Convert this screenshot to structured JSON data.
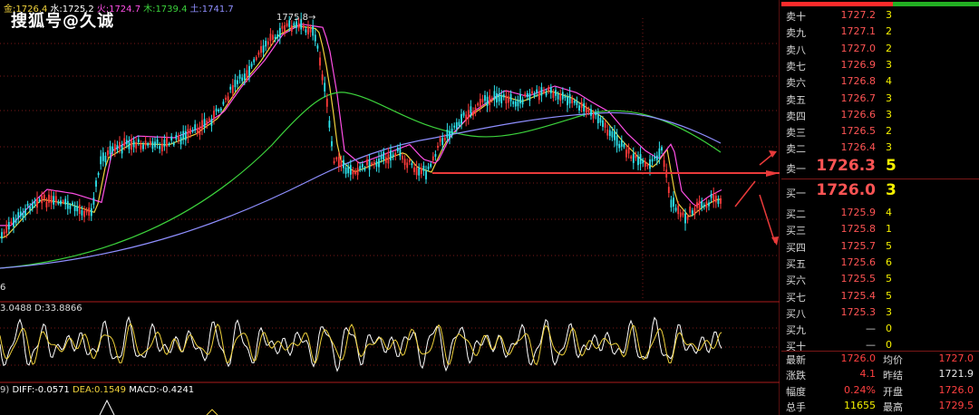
{
  "watermark": "搜狐号@久诚",
  "ma_legend": [
    {
      "text": "金:1726.4",
      "color": "#f0d23c"
    },
    {
      "text": "水:1725.2",
      "color": "#ffffff"
    },
    {
      "text": "火:1724.7",
      "color": "#ff4fe6"
    },
    {
      "text": "木:1739.4",
      "color": "#3cd23c"
    },
    {
      "text": "土:1741.7",
      "color": "#8f8fff"
    }
  ],
  "peak_label": "1775.8→",
  "y_edge_label": "6",
  "kdj_legend": "3.0488 D:33.8866",
  "macd_legend": [
    {
      "text": "9) ",
      "color": "#cccccc"
    },
    {
      "text": "DIFF:-0.0571 ",
      "color": "#ffffff"
    },
    {
      "text": "DEA:0.1549 ",
      "color": "#f0d23c"
    },
    {
      "text": "MACD:-0.4241",
      "color": "#ffffff"
    }
  ],
  "orderbook": {
    "asks": [
      {
        "label": "卖十",
        "price": "1727.2",
        "vol": "3"
      },
      {
        "label": "卖九",
        "price": "1727.1",
        "vol": "2"
      },
      {
        "label": "卖八",
        "price": "1727.0",
        "vol": "2"
      },
      {
        "label": "卖七",
        "price": "1726.9",
        "vol": "3"
      },
      {
        "label": "卖六",
        "price": "1726.8",
        "vol": "4"
      },
      {
        "label": "卖五",
        "price": "1726.7",
        "vol": "3"
      },
      {
        "label": "卖四",
        "price": "1726.6",
        "vol": "3"
      },
      {
        "label": "卖三",
        "price": "1726.5",
        "vol": "2"
      },
      {
        "label": "卖二",
        "price": "1726.4",
        "vol": "3"
      },
      {
        "label": "卖一",
        "price": "1726.3",
        "vol": "5"
      }
    ],
    "bids": [
      {
        "label": "买一",
        "price": "1726.0",
        "vol": "3"
      },
      {
        "label": "买二",
        "price": "1725.9",
        "vol": "4"
      },
      {
        "label": "买三",
        "price": "1725.8",
        "vol": "1"
      },
      {
        "label": "买四",
        "price": "1725.7",
        "vol": "5"
      },
      {
        "label": "买五",
        "price": "1725.6",
        "vol": "6"
      },
      {
        "label": "买六",
        "price": "1725.5",
        "vol": "5"
      },
      {
        "label": "买七",
        "price": "1725.4",
        "vol": "5"
      },
      {
        "label": "买八",
        "price": "1725.3",
        "vol": "3"
      },
      {
        "label": "买九",
        "price": "—",
        "vol": "0"
      },
      {
        "label": "买十",
        "price": "—",
        "vol": "0"
      }
    ],
    "stats": [
      {
        "l1": "最新",
        "v1": "1726.0",
        "c1": "#ff4040",
        "l2": "均价",
        "v2": "1727.0",
        "c2": "#ff4040"
      },
      {
        "l1": "涨跌",
        "v1": "4.1",
        "c1": "#ff4040",
        "l2": "昨结",
        "v2": "1721.9",
        "c2": "#e8e8e8"
      },
      {
        "l1": "幅度",
        "v1": "0.24%",
        "c1": "#ff4040",
        "l2": "开盘",
        "v2": "1726.0",
        "c2": "#ff4040"
      },
      {
        "l1": "总手",
        "v1": "11655",
        "c1": "#f4f000",
        "l2": "最高",
        "v2": "1729.5",
        "c2": "#ff4040"
      }
    ]
  },
  "colors": {
    "background": "#000000",
    "grid_red": "#7a1818",
    "annotation_arrow": "#e83a3a",
    "candle_up": "#ff3b3b",
    "candle_down": "#2ee6f0"
  }
}
